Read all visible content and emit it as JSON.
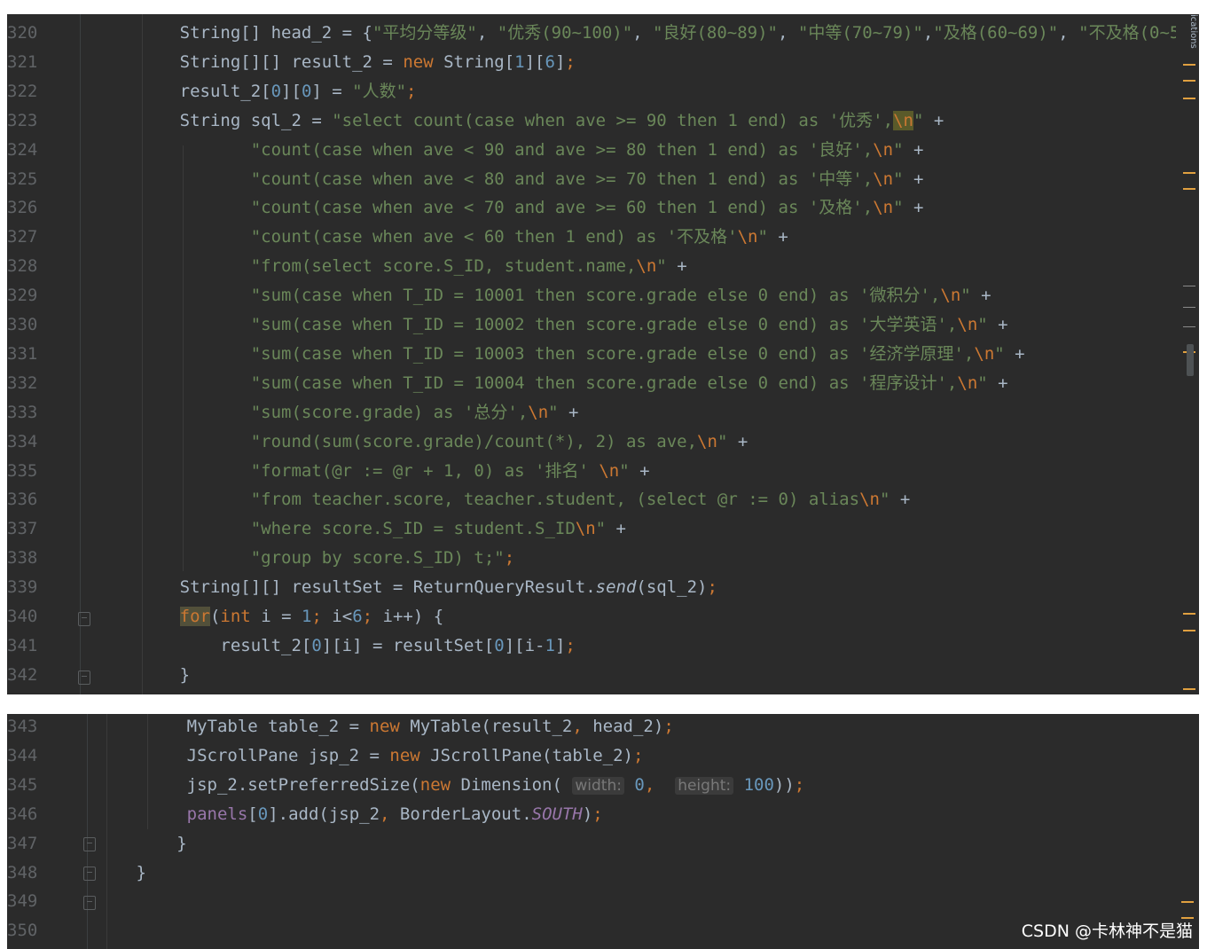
{
  "editor": {
    "side_tab_label": "ications",
    "watermark": "CSDN @卡林神不是猫",
    "panel1_lines": [
      {
        "num": "320",
        "indent": "      ",
        "tokens": [
          [
            "plain",
            "String[] head_2 = {"
          ],
          [
            "str",
            "\"平均分等级\""
          ],
          [
            "plain",
            ", "
          ],
          [
            "str",
            "\"优秀(90~100)\""
          ],
          [
            "plain",
            ", "
          ],
          [
            "str",
            "\"良好(80~89)\""
          ],
          [
            "plain",
            ", "
          ],
          [
            "str",
            "\"中等(70~79)\""
          ],
          [
            "plain",
            ","
          ],
          [
            "str",
            "\"及格(60~69)\""
          ],
          [
            "plain",
            ", "
          ],
          [
            "str",
            "\"不及格(0~5"
          ]
        ]
      },
      {
        "num": "321",
        "indent": "      ",
        "tokens": [
          [
            "plain",
            "String[][] result_2 = "
          ],
          [
            "kw",
            "new "
          ],
          [
            "plain",
            "String["
          ],
          [
            "num",
            "1"
          ],
          [
            "plain",
            "]["
          ],
          [
            "num",
            "6"
          ],
          [
            "plain",
            "]"
          ],
          [
            "kw",
            ";"
          ]
        ]
      },
      {
        "num": "322",
        "indent": "      ",
        "tokens": [
          [
            "plain",
            "result_2["
          ],
          [
            "num",
            "0"
          ],
          [
            "plain",
            "]["
          ],
          [
            "num",
            "0"
          ],
          [
            "plain",
            "] = "
          ],
          [
            "str",
            "\"人数\""
          ],
          [
            "kw",
            ";"
          ]
        ]
      },
      {
        "num": "323",
        "indent": "      ",
        "tokens": [
          [
            "plain",
            "String sql_2 = "
          ],
          [
            "str",
            "\"select count(case when ave >= 90 then 1 end) as '优秀',"
          ],
          [
            "hl",
            "\\n"
          ],
          [
            "str",
            "\""
          ],
          [
            "plain",
            " +"
          ]
        ]
      },
      {
        "num": "324",
        "indent": "             ",
        "tokens": [
          [
            "str",
            "\"count(case when ave < 90 and ave >= 80 then 1 end) as '良好',"
          ],
          [
            "esc",
            "\\n"
          ],
          [
            "str",
            "\""
          ],
          [
            "plain",
            " +"
          ]
        ]
      },
      {
        "num": "325",
        "indent": "             ",
        "tokens": [
          [
            "str",
            "\"count(case when ave < 80 and ave >= 70 then 1 end) as '中等',"
          ],
          [
            "esc",
            "\\n"
          ],
          [
            "str",
            "\""
          ],
          [
            "plain",
            " +"
          ]
        ]
      },
      {
        "num": "326",
        "indent": "             ",
        "tokens": [
          [
            "str",
            "\"count(case when ave < 70 and ave >= 60 then 1 end) as '及格',"
          ],
          [
            "esc",
            "\\n"
          ],
          [
            "str",
            "\""
          ],
          [
            "plain",
            " +"
          ]
        ]
      },
      {
        "num": "327",
        "indent": "             ",
        "tokens": [
          [
            "str",
            "\"count(case when ave < 60 then 1 end) as '不及格'"
          ],
          [
            "esc",
            "\\n"
          ],
          [
            "str",
            "\""
          ],
          [
            "plain",
            " +"
          ]
        ]
      },
      {
        "num": "328",
        "indent": "             ",
        "tokens": [
          [
            "str",
            "\"from(select score.S_ID, student.name,"
          ],
          [
            "esc",
            "\\n"
          ],
          [
            "str",
            "\""
          ],
          [
            "plain",
            " +"
          ]
        ]
      },
      {
        "num": "329",
        "indent": "             ",
        "tokens": [
          [
            "str",
            "\"sum(case when T_ID = 10001 then score.grade else 0 end) as '微积分',"
          ],
          [
            "esc",
            "\\n"
          ],
          [
            "str",
            "\""
          ],
          [
            "plain",
            " +"
          ]
        ]
      },
      {
        "num": "330",
        "indent": "             ",
        "tokens": [
          [
            "str",
            "\"sum(case when T_ID = 10002 then score.grade else 0 end) as '大学英语',"
          ],
          [
            "esc",
            "\\n"
          ],
          [
            "str",
            "\""
          ],
          [
            "plain",
            " +"
          ]
        ]
      },
      {
        "num": "331",
        "indent": "             ",
        "tokens": [
          [
            "str",
            "\"sum(case when T_ID = 10003 then score.grade else 0 end) as '经济学原理',"
          ],
          [
            "esc",
            "\\n"
          ],
          [
            "str",
            "\""
          ],
          [
            "plain",
            " +"
          ]
        ]
      },
      {
        "num": "332",
        "indent": "             ",
        "tokens": [
          [
            "str",
            "\"sum(case when T_ID = 10004 then score.grade else 0 end) as '程序设计',"
          ],
          [
            "esc",
            "\\n"
          ],
          [
            "str",
            "\""
          ],
          [
            "plain",
            " +"
          ]
        ]
      },
      {
        "num": "333",
        "indent": "             ",
        "tokens": [
          [
            "str",
            "\"sum(score.grade) as '总分',"
          ],
          [
            "esc",
            "\\n"
          ],
          [
            "str",
            "\""
          ],
          [
            "plain",
            " +"
          ]
        ]
      },
      {
        "num": "334",
        "indent": "             ",
        "tokens": [
          [
            "str",
            "\"round(sum(score.grade)/count(*), 2) as ave,"
          ],
          [
            "esc",
            "\\n"
          ],
          [
            "str",
            "\""
          ],
          [
            "plain",
            " +"
          ]
        ]
      },
      {
        "num": "335",
        "indent": "             ",
        "tokens": [
          [
            "str",
            "\"format(@r := @r + 1, 0) as '排名' "
          ],
          [
            "esc",
            "\\n"
          ],
          [
            "str",
            "\""
          ],
          [
            "plain",
            " +"
          ]
        ]
      },
      {
        "num": "336",
        "indent": "             ",
        "tokens": [
          [
            "str",
            "\"from teacher.score, teacher.student, (select @r := 0) alias"
          ],
          [
            "esc",
            "\\n"
          ],
          [
            "str",
            "\""
          ],
          [
            "plain",
            " +"
          ]
        ]
      },
      {
        "num": "337",
        "indent": "             ",
        "tokens": [
          [
            "str",
            "\"where score.S_ID = student.S_ID"
          ],
          [
            "esc",
            "\\n"
          ],
          [
            "str",
            "\""
          ],
          [
            "plain",
            " +"
          ]
        ]
      },
      {
        "num": "338",
        "indent": "             ",
        "tokens": [
          [
            "str",
            "\"group by score.S_ID) t;\""
          ],
          [
            "kw",
            ";"
          ]
        ]
      },
      {
        "num": "339",
        "indent": "      ",
        "tokens": [
          [
            "plain",
            "String[][] resultSet = ReturnQueryResult."
          ],
          [
            "italic",
            "send"
          ],
          [
            "plain",
            "(sql_2)"
          ],
          [
            "kw",
            ";"
          ]
        ]
      },
      {
        "num": "340",
        "indent": "      ",
        "tokens": [
          [
            "hlk",
            "for"
          ],
          [
            "plain",
            "("
          ],
          [
            "kw",
            "int "
          ],
          [
            "plain",
            "i = "
          ],
          [
            "num",
            "1"
          ],
          [
            "kw",
            "; "
          ],
          [
            "plain",
            "i<"
          ],
          [
            "num",
            "6"
          ],
          [
            "kw",
            "; "
          ],
          [
            "plain",
            "i++) {"
          ]
        ]
      },
      {
        "num": "341",
        "indent": "          ",
        "tokens": [
          [
            "plain",
            "result_2["
          ],
          [
            "num",
            "0"
          ],
          [
            "plain",
            "][i] = resultSet["
          ],
          [
            "num",
            "0"
          ],
          [
            "plain",
            "][i-"
          ],
          [
            "num",
            "1"
          ],
          [
            "plain",
            "]"
          ],
          [
            "kw",
            ";"
          ]
        ]
      },
      {
        "num": "342",
        "indent": "      ",
        "tokens": [
          [
            "plain",
            "}"
          ]
        ]
      }
    ],
    "panel2_lines": [
      {
        "num": "343",
        "indent": "      ",
        "tokens": [
          [
            "plain",
            "MyTable table_2 = "
          ],
          [
            "kw",
            "new "
          ],
          [
            "plain",
            "MyTable(result_2"
          ],
          [
            "kw",
            ", "
          ],
          [
            "plain",
            "head_2)"
          ],
          [
            "kw",
            ";"
          ]
        ]
      },
      {
        "num": "344",
        "indent": "      ",
        "tokens": [
          [
            "plain",
            "JScrollPane jsp_2 = "
          ],
          [
            "kw",
            "new "
          ],
          [
            "plain",
            "JScrollPane(table_2)"
          ],
          [
            "kw",
            ";"
          ]
        ]
      },
      {
        "num": "345",
        "indent": "      ",
        "tokens": [
          [
            "plain",
            "jsp_2.setPreferredSize("
          ],
          [
            "kw",
            "new "
          ],
          [
            "plain",
            "Dimension( "
          ],
          [
            "hint",
            "width:"
          ],
          [
            "plain",
            " "
          ],
          [
            "num",
            "0"
          ],
          [
            "kw",
            ", "
          ],
          [
            "plain",
            " "
          ],
          [
            "hint",
            "height:"
          ],
          [
            "plain",
            " "
          ],
          [
            "num",
            "100"
          ],
          [
            "plain",
            "))"
          ],
          [
            "kw",
            ";"
          ]
        ]
      },
      {
        "num": "346",
        "indent": "      ",
        "tokens": [
          [
            "field",
            "panels"
          ],
          [
            "plain",
            "["
          ],
          [
            "num",
            "0"
          ],
          [
            "plain",
            "].add(jsp_2"
          ],
          [
            "kw",
            ", "
          ],
          [
            "plain",
            "BorderLayout."
          ],
          [
            "static",
            "SOUTH"
          ],
          [
            "plain",
            ")"
          ],
          [
            "kw",
            ";"
          ]
        ]
      },
      {
        "num": "347",
        "indent": "     ",
        "tokens": [
          [
            "plain",
            "}"
          ]
        ]
      },
      {
        "num": "348",
        "indent": " ",
        "tokens": [
          [
            "plain",
            "}"
          ]
        ]
      },
      {
        "num": "349",
        "indent": "",
        "tokens": []
      },
      {
        "num": "350",
        "indent": "",
        "tokens": []
      }
    ]
  }
}
